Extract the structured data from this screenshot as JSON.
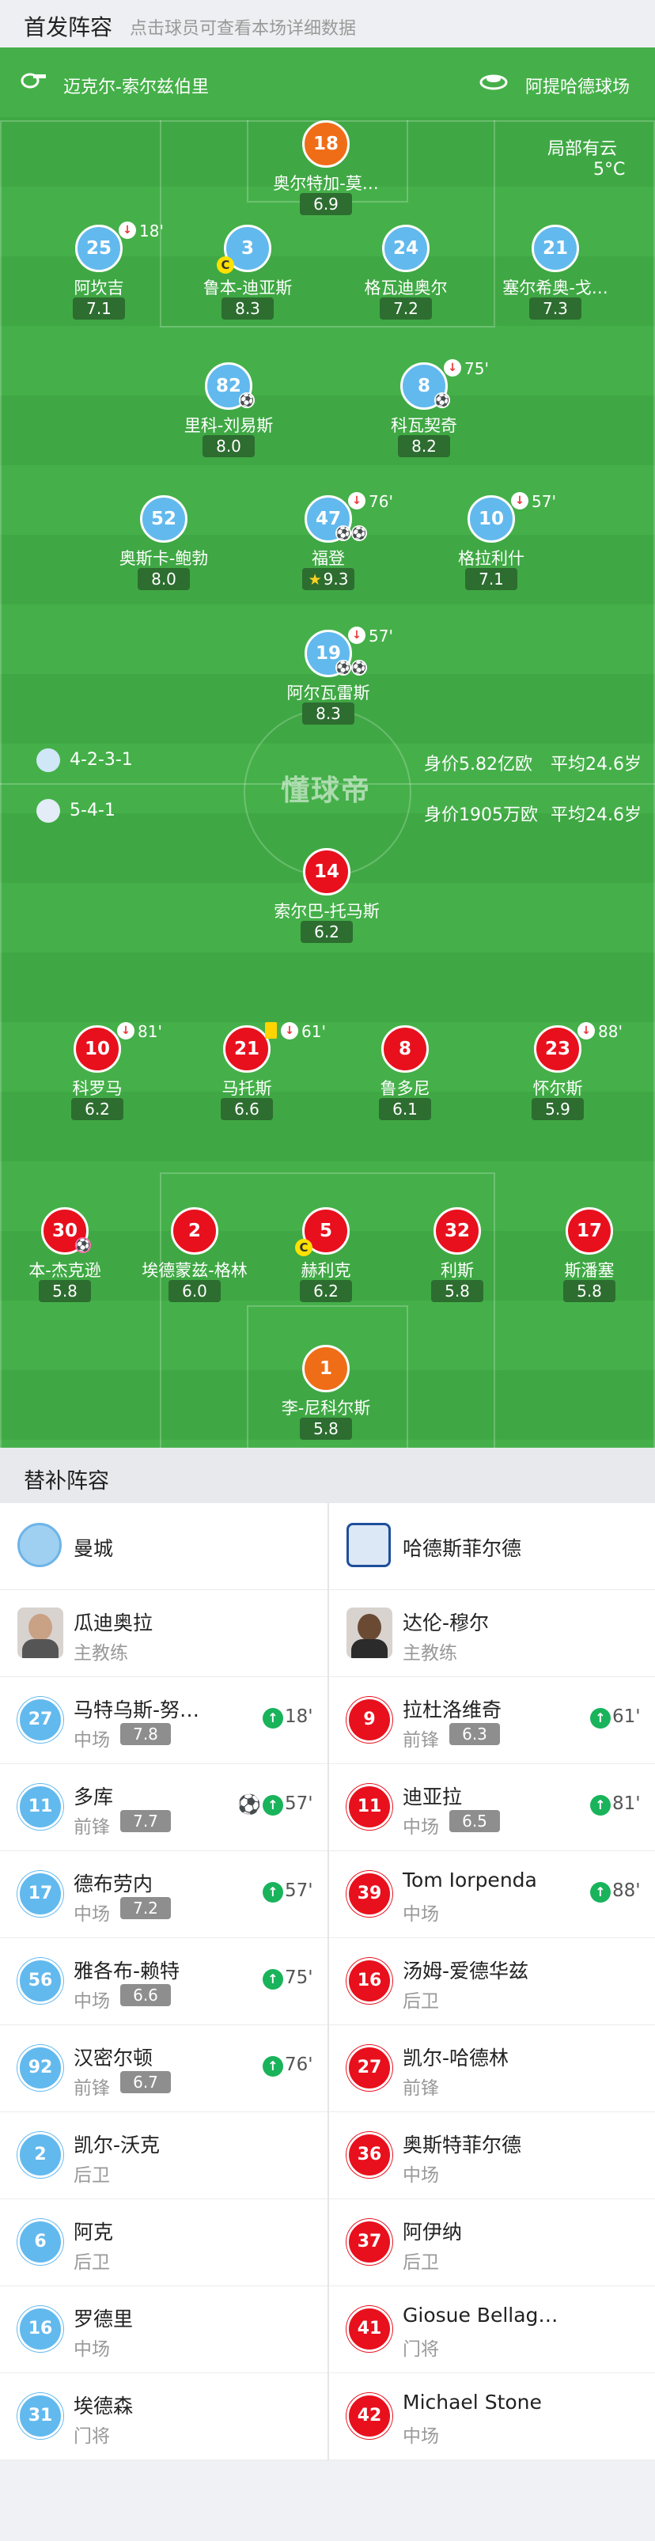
{
  "header": {
    "title": "首发阵容",
    "subtitle": "点击球员可查看本场详细数据"
  },
  "pitch_info": {
    "home_stadium": "迈克尔-索尔兹伯里",
    "stadium": "阿提哈德球场",
    "weather": "局部有云",
    "temperature": "5°C",
    "watermark": "懂球帝"
  },
  "home": {
    "formation": "4-2-3-1",
    "value": "身价5.82亿欧",
    "avg_age": "平均24.6岁",
    "players": [
      {
        "num": "18",
        "name": "奥尔特加-莫…",
        "rating": "6.9",
        "color": "orange"
      },
      {
        "num": "25",
        "name": "阿坎吉",
        "rating": "7.1",
        "sub_out": "18'"
      },
      {
        "num": "3",
        "name": "鲁本-迪亚斯",
        "rating": "8.3",
        "captain": "C"
      },
      {
        "num": "24",
        "name": "格瓦迪奥尔",
        "rating": "7.2"
      },
      {
        "num": "21",
        "name": "塞尔希奥-戈…",
        "rating": "7.3"
      },
      {
        "num": "82",
        "name": "里科-刘易斯",
        "rating": "8.0"
      },
      {
        "num": "8",
        "name": "科瓦契奇",
        "rating": "8.2",
        "sub_out": "75'"
      },
      {
        "num": "52",
        "name": "奥斯卡-鲍勃",
        "rating": "8.0"
      },
      {
        "num": "47",
        "name": "福登",
        "rating": "9.3",
        "sub_out": "76'",
        "star": true
      },
      {
        "num": "10",
        "name": "格拉利什",
        "rating": "7.1",
        "sub_out": "57'"
      },
      {
        "num": "19",
        "name": "阿尔瓦雷斯",
        "rating": "8.3",
        "sub_out": "57'"
      }
    ]
  },
  "away": {
    "formation": "5-4-1",
    "value": "身价1905万欧",
    "avg_age": "平均24.6岁",
    "players": [
      {
        "num": "14",
        "name": "索尔巴-托马斯",
        "rating": "6.2"
      },
      {
        "num": "10",
        "name": "科罗马",
        "rating": "6.2",
        "sub_out": "81'"
      },
      {
        "num": "21",
        "name": "马托斯",
        "rating": "6.6",
        "sub_out": "61'"
      },
      {
        "num": "8",
        "name": "鲁多尼",
        "rating": "6.1"
      },
      {
        "num": "23",
        "name": "怀尔斯",
        "rating": "5.9",
        "sub_out": "88'"
      },
      {
        "num": "30",
        "name": "本-杰克逊",
        "rating": "5.8"
      },
      {
        "num": "2",
        "name": "埃德蒙兹-格林",
        "rating": "6.0"
      },
      {
        "num": "5",
        "name": "赫利克",
        "rating": "6.2",
        "captain": "C"
      },
      {
        "num": "32",
        "name": "利斯",
        "rating": "5.8"
      },
      {
        "num": "17",
        "name": "斯潘塞",
        "rating": "5.8"
      },
      {
        "num": "1",
        "name": "李-尼科尔斯",
        "rating": "5.8",
        "color": "orange"
      }
    ]
  },
  "subs_section": {
    "title": "替补阵容",
    "coach_label": "主教练"
  },
  "home_team": {
    "name": "曼城",
    "coach": "瓜迪奥拉"
  },
  "away_team": {
    "name": "哈德斯菲尔德",
    "coach": "达伦-穆尔"
  },
  "home_subs": [
    {
      "num": "27",
      "name": "马特乌斯-努…",
      "pos": "中场",
      "rating": "7.8",
      "sub_in": "18'"
    },
    {
      "num": "11",
      "name": "多库",
      "pos": "前锋",
      "rating": "7.7",
      "sub_in": "57'",
      "goal": true
    },
    {
      "num": "17",
      "name": "德布劳内",
      "pos": "中场",
      "rating": "7.2",
      "sub_in": "57'"
    },
    {
      "num": "56",
      "name": "雅各布-赖特",
      "pos": "中场",
      "rating": "6.6",
      "sub_in": "75'"
    },
    {
      "num": "92",
      "name": "汉密尔顿",
      "pos": "前锋",
      "rating": "6.7",
      "sub_in": "76'"
    },
    {
      "num": "2",
      "name": "凯尔-沃克",
      "pos": "后卫"
    },
    {
      "num": "6",
      "name": "阿克",
      "pos": "后卫"
    },
    {
      "num": "16",
      "name": "罗德里",
      "pos": "中场"
    },
    {
      "num": "31",
      "name": "埃德森",
      "pos": "门将"
    }
  ],
  "away_subs": [
    {
      "num": "9",
      "name": "拉杜洛维奇",
      "pos": "前锋",
      "rating": "6.3",
      "sub_in": "61'"
    },
    {
      "num": "11",
      "name": "迪亚拉",
      "pos": "中场",
      "rating": "6.5",
      "sub_in": "81'"
    },
    {
      "num": "39",
      "name": "Tom Iorpenda",
      "pos": "中场",
      "sub_in": "88'"
    },
    {
      "num": "16",
      "name": "汤姆-爱德华兹",
      "pos": "后卫"
    },
    {
      "num": "27",
      "name": "凯尔-哈德林",
      "pos": "前锋"
    },
    {
      "num": "36",
      "name": "奥斯特菲尔德",
      "pos": "中场"
    },
    {
      "num": "37",
      "name": "阿伊纳",
      "pos": "后卫"
    },
    {
      "num": "41",
      "name": "Giosue Bellag…",
      "pos": "门将"
    },
    {
      "num": "42",
      "name": "Michael Stone",
      "pos": "中场"
    }
  ],
  "colors": {
    "home": "#62b9ee",
    "away": "#e8101d",
    "gk": "#f06d17",
    "pitch": "#45b049"
  }
}
